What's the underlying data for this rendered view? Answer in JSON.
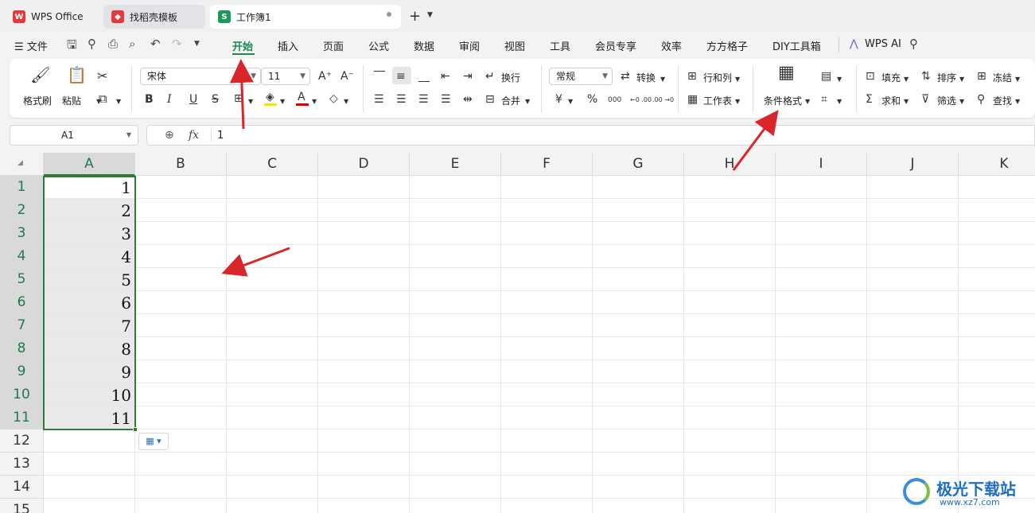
{
  "tabs": [
    {
      "label": "WPS Office",
      "icon": "wps-logo-icon"
    },
    {
      "label": "找稻壳模板",
      "icon": "docer-icon"
    },
    {
      "label": "工作簿1",
      "icon": "sheet-icon",
      "icon_text": "S"
    }
  ],
  "menu": {
    "file_label": "文件",
    "items": [
      "开始",
      "插入",
      "页面",
      "公式",
      "数据",
      "审阅",
      "视图",
      "工具",
      "会员专享",
      "效率",
      "方方格子",
      "DIY工具箱"
    ],
    "active": "开始",
    "ai_label": "WPS AI"
  },
  "ribbon": {
    "format_painter": "格式刷",
    "paste": "粘贴",
    "font_name": "宋体",
    "font_size": "11",
    "wrap": "换行",
    "merge": "合并",
    "number_format": "常规",
    "convert": "转换",
    "rows_cols": "行和列",
    "worksheet": "工作表",
    "cond_format": "条件格式",
    "fill": "填充",
    "sort": "排序",
    "freeze": "冻结",
    "sum": "求和",
    "filter": "筛选",
    "find": "查找",
    "bold": "B",
    "italic": "I",
    "underline": "U",
    "strike": "S",
    "currency": "¥",
    "percent": "%",
    "thousands": "000",
    "dec_inc": "←0 .00",
    "dec_dec": ".00 →0"
  },
  "formula_bar": {
    "cell_ref": "A1",
    "fx": "fx",
    "value": "1"
  },
  "columns": [
    "A",
    "B",
    "C",
    "D",
    "E",
    "F",
    "G",
    "H",
    "I",
    "J",
    "K"
  ],
  "rows": [
    "1",
    "2",
    "3",
    "4",
    "5",
    "6",
    "7",
    "8",
    "9",
    "10",
    "11",
    "12",
    "13",
    "14",
    "15"
  ],
  "cells_a": [
    "1",
    "2",
    "3",
    "4",
    "5",
    "6",
    "7",
    "8",
    "9",
    "10",
    "11"
  ],
  "watermark": {
    "text": "极光下载站",
    "url": "www.xz7.com"
  },
  "colors": {
    "accent": "#2e7d32",
    "arrow": "#d9262a",
    "wps_red": "#e8373e",
    "sheet_green": "#1a9a5a"
  }
}
